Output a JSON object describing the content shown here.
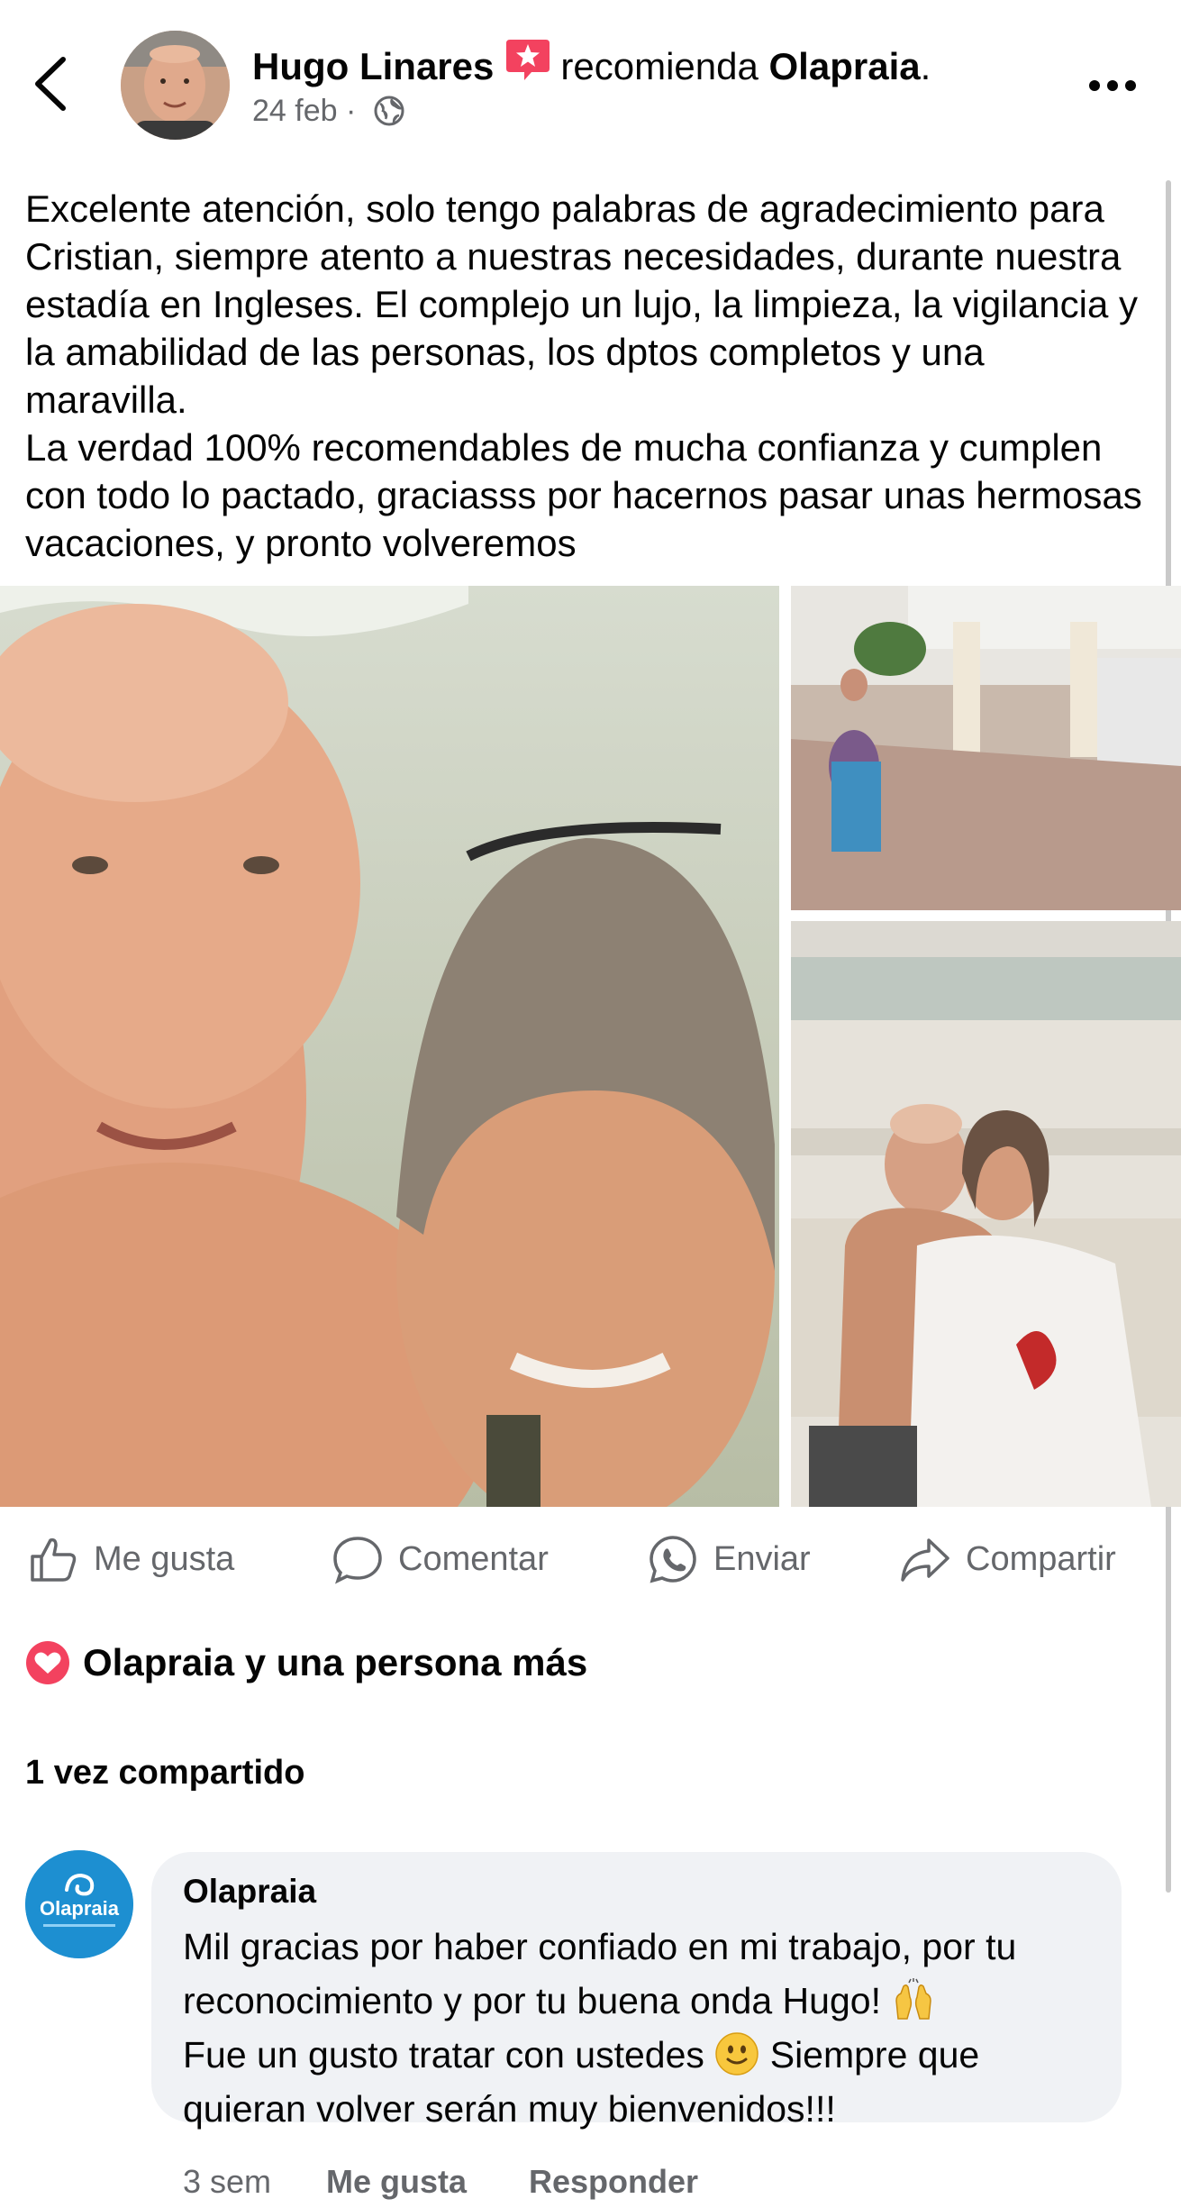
{
  "post": {
    "author": "Hugo Linares",
    "verb": "recomienda",
    "page": "Olapraia",
    "period": ".",
    "date": "24 feb",
    "separator": "·",
    "text_paragraph_1": "Excelente atención, solo tengo palabras de agradecimiento para Cristian, siempre atento a nuestras necesidades, durante nuestra estadía en Ingleses. El complejo un lujo, la limpieza, la vigilancia y la amabilidad de las personas, los dptos completos y una maravilla.",
    "text_paragraph_2": "La verdad 100% recomendables de mucha confianza y cumplen con todo lo pactado, graciasss por hacernos pasar unas hermosas vacaciones, y pronto volveremos"
  },
  "actions": {
    "like": "Me gusta",
    "comment": "Comentar",
    "send": "Enviar",
    "share": "Compartir"
  },
  "reactions_text": "Olapraia y una persona más",
  "shares_text": "1 vez compartido",
  "comment": {
    "author": "Olapraia",
    "avatar_text": "Olapraia",
    "line_1": "Mil gracias por haber confiado en mi trabajo, por tu reconocimiento y por tu buena onda Hugo!",
    "line_2a": "Fue un gusto tratar con ustedes",
    "line_2b": "Siempre que quieran volver serán muy bienvenidos!!!",
    "time": "3 sem",
    "like": "Me gusta",
    "reply": "Responder"
  },
  "icons": {
    "back": "chevron-left-icon",
    "more": "more-dots-icon",
    "star": "recommend-star-icon",
    "globe": "globe-icon",
    "like": "thumbs-up-icon",
    "comment": "comment-bubble-icon",
    "send": "whatsapp-icon",
    "share": "share-arrow-icon",
    "heart": "love-reaction-icon"
  },
  "colors": {
    "text": "#050505",
    "secondary": "#65676b",
    "badge_pink": "#f3425f",
    "brand_blue": "#1d8fd1",
    "bubble": "#f0f2f5"
  }
}
